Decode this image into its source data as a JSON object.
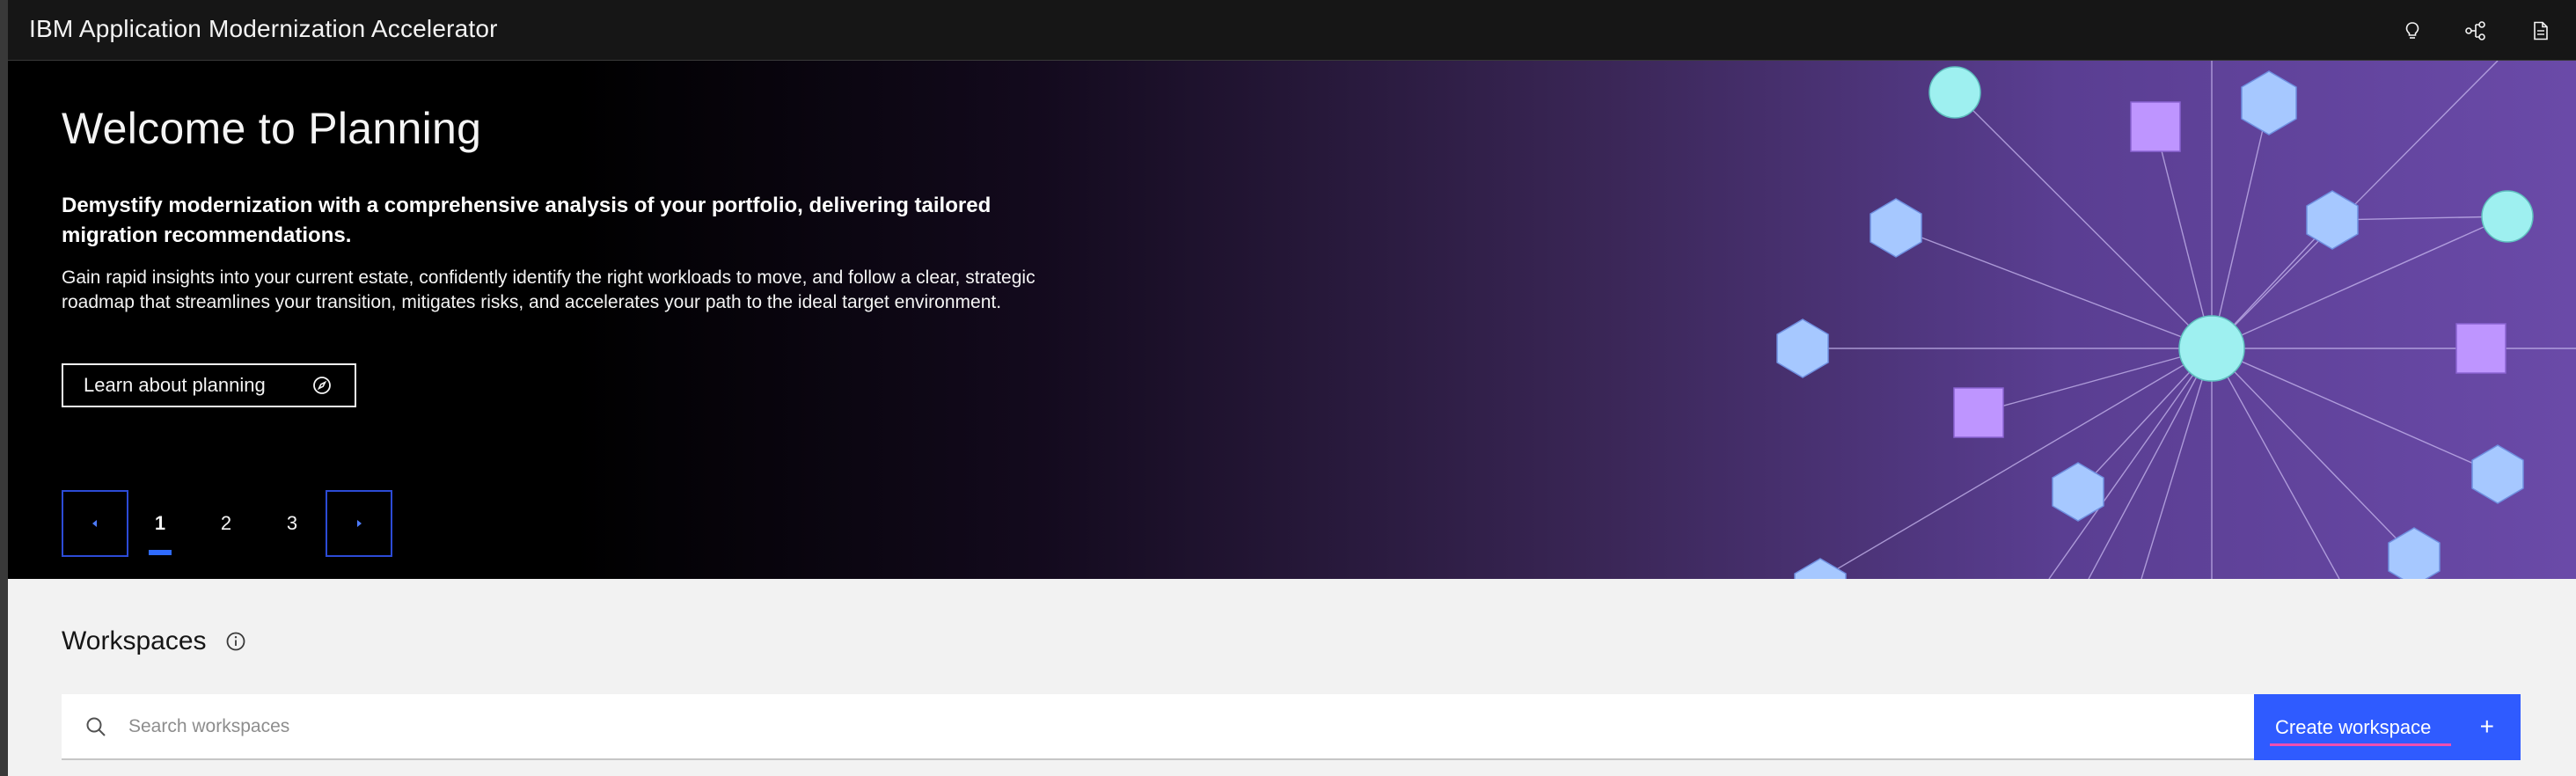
{
  "header": {
    "app_title": "IBM Application Modernization Accelerator",
    "actions": [
      {
        "icon": "lightbulb-icon"
      },
      {
        "icon": "share-network-icon"
      },
      {
        "icon": "document-icon"
      }
    ]
  },
  "hero": {
    "title": "Welcome to Planning",
    "subtitle": "Demystify modernization with a comprehensive analysis of your portfolio, delivering tailored migration recommendations.",
    "body": "Gain rapid insights into your current estate, confidently identify the right workloads to move, and follow a clear, strategic roadmap that streamlines your transition, mitigates risks, and accelerates your path to the ideal target environment.",
    "learn_button": "Learn about planning",
    "pager": {
      "pages": [
        "1",
        "2",
        "3"
      ],
      "active_page": "1"
    }
  },
  "workspaces": {
    "title": "Workspaces",
    "search_placeholder": "Search workspaces",
    "create_button": "Create workspace",
    "create_icon": "+"
  },
  "colors": {
    "header_bg": "#161616",
    "accent_blue": "#2f5bff",
    "hex_node": "#a6c8ff",
    "square_node": "#be95ff",
    "circle_node": "#9ef0f0",
    "focus_pink": "#f04fb0"
  }
}
